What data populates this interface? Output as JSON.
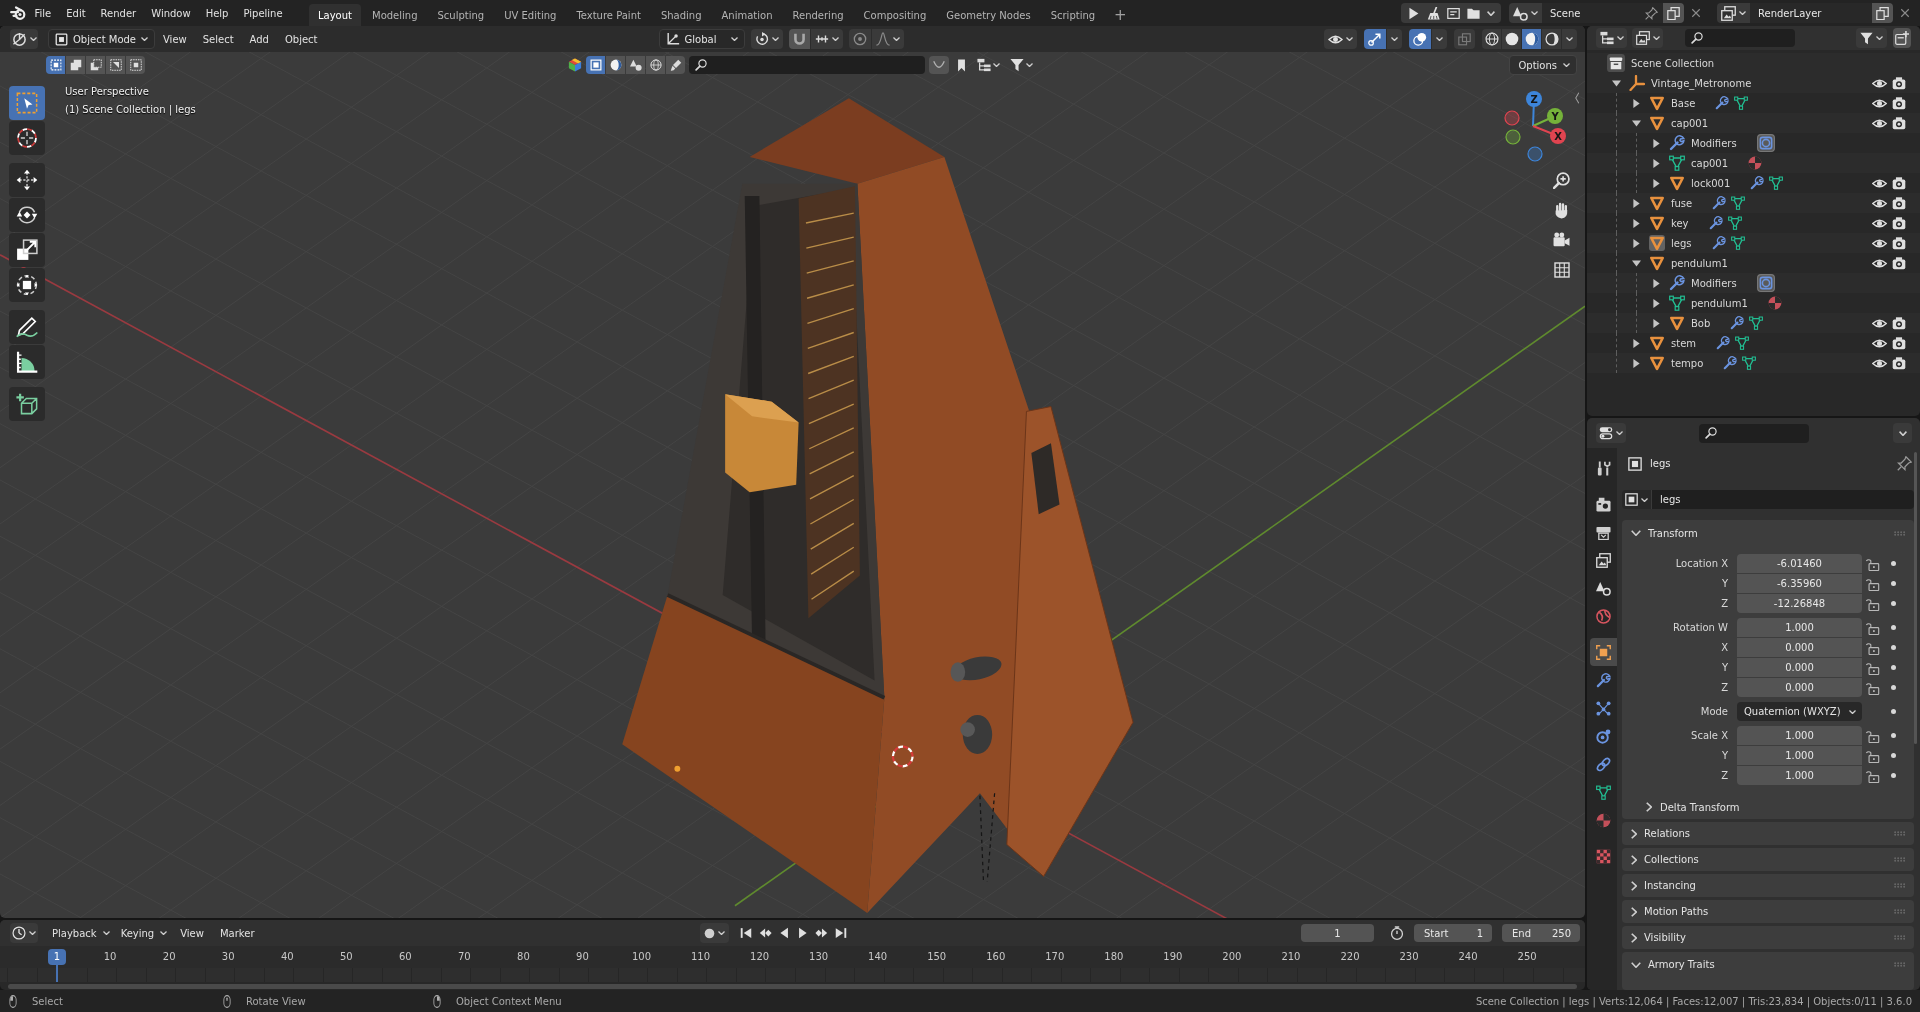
{
  "topbar": {
    "menus": [
      "File",
      "Edit",
      "Render",
      "Window",
      "Help",
      "Pipeline"
    ],
    "workspaces": [
      {
        "label": "Layout",
        "selected": true
      },
      {
        "label": "Modeling",
        "selected": false
      },
      {
        "label": "Sculpting",
        "selected": false
      },
      {
        "label": "UV Editing",
        "selected": false
      },
      {
        "label": "Texture Paint",
        "selected": false
      },
      {
        "label": "Shading",
        "selected": false
      },
      {
        "label": "Animation",
        "selected": false
      },
      {
        "label": "Rendering",
        "selected": false
      },
      {
        "label": "Compositing",
        "selected": false
      },
      {
        "label": "Geometry Nodes",
        "selected": false
      },
      {
        "label": "Scripting",
        "selected": false
      }
    ],
    "add_workspace": "+",
    "scene": "Scene",
    "view_layer": "RenderLayer"
  },
  "viewport": {
    "header": {
      "mode": "Object Mode",
      "menus": [
        "View",
        "Select",
        "Add",
        "Object"
      ],
      "orientation": "Global",
      "select_modes": [
        {
          "kind": "set",
          "selected": true
        },
        {
          "kind": "extend",
          "selected": false
        },
        {
          "kind": "subtract",
          "selected": false
        },
        {
          "kind": "invert",
          "selected": false
        },
        {
          "kind": "intersect",
          "selected": false
        }
      ],
      "filters": [
        {
          "kind": "object",
          "selected": true
        },
        {
          "kind": "sphere",
          "selected": false
        },
        {
          "kind": "shapes",
          "selected": false
        },
        {
          "kind": "world",
          "selected": false
        },
        {
          "kind": "brush",
          "selected": false
        }
      ],
      "show_gizmos": true,
      "show_overlays": true,
      "xray": false,
      "shading": [
        {
          "kind": "wireframe",
          "selected": false
        },
        {
          "kind": "solid",
          "selected": false
        },
        {
          "kind": "material",
          "selected": true
        },
        {
          "kind": "rendered",
          "selected": false
        }
      ],
      "options": "Options"
    },
    "info": [
      "User Perspective",
      "(1) Scene Collection | legs"
    ],
    "tools": [
      {
        "kind": "select",
        "selected": true
      },
      {
        "kind": "cursor",
        "selected": false
      },
      {
        "kind": "move",
        "selected": false
      },
      {
        "kind": "rotate",
        "selected": false
      },
      {
        "kind": "scale",
        "selected": false
      },
      {
        "kind": "transform",
        "selected": false
      },
      {
        "kind": "annotate",
        "selected": false
      },
      {
        "kind": "measure",
        "selected": false
      },
      {
        "kind": "add_cube",
        "selected": false
      }
    ],
    "gizmo": [
      {
        "label": "Z",
        "color": "#3d85da"
      },
      {
        "label": "Y",
        "color": "#75b23a"
      },
      {
        "label": "X",
        "color": "#e04450"
      }
    ]
  },
  "outliner": {
    "root": "Scene Collection",
    "tree": [
      {
        "name": "Vintage_Metronome",
        "kind": "empty",
        "expanded": true,
        "selected": false,
        "visible": true,
        "renderable": true,
        "children": [
          {
            "name": "Base",
            "kind": "object",
            "expanded": false,
            "selected": false,
            "visible": true,
            "renderable": true
          },
          {
            "name": "cap001",
            "kind": "object",
            "expanded": true,
            "selected": false,
            "visible": true,
            "renderable": true,
            "children": [
              {
                "name": "Modifiers",
                "kind": "modifiers",
                "expanded": false,
                "selected": false
              },
              {
                "name": "cap001",
                "kind": "mesh",
                "expanded": false,
                "selected": false
              },
              {
                "name": "lock001",
                "kind": "object",
                "expanded": false,
                "selected": false,
                "visible": true,
                "renderable": true
              }
            ]
          },
          {
            "name": "fuse",
            "kind": "object",
            "expanded": false,
            "selected": false,
            "visible": true,
            "renderable": true
          },
          {
            "name": "key",
            "kind": "object",
            "expanded": false,
            "selected": false,
            "visible": true,
            "renderable": true
          },
          {
            "name": "legs",
            "kind": "object",
            "expanded": false,
            "selected": true,
            "visible": true,
            "renderable": true
          },
          {
            "name": "pendulum1",
            "kind": "object",
            "expanded": true,
            "selected": false,
            "visible": true,
            "renderable": true,
            "children": [
              {
                "name": "Modifiers",
                "kind": "modifiers",
                "expanded": false,
                "selected": false
              },
              {
                "name": "pendulum1",
                "kind": "mesh",
                "expanded": false,
                "selected": false
              },
              {
                "name": "Bob",
                "kind": "object",
                "expanded": false,
                "selected": false,
                "visible": true,
                "renderable": true
              }
            ]
          },
          {
            "name": "stem",
            "kind": "object",
            "expanded": false,
            "selected": false,
            "visible": true,
            "renderable": true
          },
          {
            "name": "tempo",
            "kind": "object",
            "expanded": false,
            "selected": false,
            "visible": true,
            "renderable": true
          }
        ]
      }
    ]
  },
  "properties": {
    "tabs": [
      {
        "kind": "tool",
        "selected": false
      },
      {
        "kind": "render",
        "selected": false
      },
      {
        "kind": "output",
        "selected": false
      },
      {
        "kind": "view_layer",
        "selected": false
      },
      {
        "kind": "scene",
        "selected": false
      },
      {
        "kind": "world",
        "selected": false
      },
      {
        "kind": "object",
        "selected": true
      },
      {
        "kind": "modifiers",
        "selected": false
      },
      {
        "kind": "particles",
        "selected": false
      },
      {
        "kind": "physics",
        "selected": false
      },
      {
        "kind": "constraints",
        "selected": false
      },
      {
        "kind": "data",
        "selected": false
      },
      {
        "kind": "material",
        "selected": false
      },
      {
        "kind": "texture",
        "selected": false
      }
    ],
    "context": "legs",
    "name": "legs",
    "panels": [
      {
        "title": "Transform",
        "expanded": true,
        "groups": [
          [
            {
              "label": "Location X",
              "value": "-6.01460",
              "kind": "number",
              "locked": false
            },
            {
              "label": "Y",
              "value": "-6.35960",
              "kind": "number",
              "locked": false
            },
            {
              "label": "Z",
              "value": "-12.26848",
              "kind": "number",
              "locked": false
            }
          ],
          [
            {
              "label": "Rotation W",
              "value": "1.000",
              "kind": "number",
              "locked": false
            },
            {
              "label": "X",
              "value": "0.000",
              "kind": "number",
              "locked": false
            },
            {
              "label": "Y",
              "value": "0.000",
              "kind": "number",
              "locked": false
            },
            {
              "label": "Z",
              "value": "0.000",
              "kind": "number",
              "locked": false
            }
          ],
          [
            {
              "label": "Mode",
              "value": "Quaternion (WXYZ)",
              "kind": "dropdown"
            }
          ],
          [
            {
              "label": "Scale X",
              "value": "1.000",
              "kind": "number",
              "locked": false
            },
            {
              "label": "Y",
              "value": "1.000",
              "kind": "number",
              "locked": false
            },
            {
              "label": "Z",
              "value": "1.000",
              "kind": "number",
              "locked": false
            }
          ]
        ],
        "subpanels": [
          {
            "title": "Delta Transform",
            "expanded": false
          }
        ]
      },
      {
        "title": "Relations",
        "expanded": false
      },
      {
        "title": "Collections",
        "expanded": false
      },
      {
        "title": "Instancing",
        "expanded": false
      },
      {
        "title": "Motion Paths",
        "expanded": false
      },
      {
        "title": "Visibility",
        "expanded": false
      },
      {
        "title": "Armory Traits",
        "expanded": true
      }
    ]
  },
  "timeline": {
    "menus": [
      "Playback",
      "Keying",
      "View",
      "Marker"
    ],
    "auto_keying": false,
    "current_frame": "1",
    "start_label": "Start",
    "start": "1",
    "end_label": "End",
    "end": "250",
    "playhead": "1",
    "ticks": [
      "10",
      "20",
      "30",
      "40",
      "50",
      "60",
      "70",
      "80",
      "90",
      "100",
      "110",
      "120",
      "130",
      "140",
      "150",
      "160",
      "170",
      "180",
      "190",
      "200",
      "210",
      "220",
      "230",
      "240",
      "250"
    ]
  },
  "status_bar": {
    "hints": [
      {
        "kind": "left",
        "text": "Select"
      },
      {
        "kind": "middle",
        "text": "Rotate View"
      },
      {
        "kind": "right",
        "text": "Object Context Menu"
      }
    ],
    "stats": "Scene Collection | legs | Verts:12,064 | Faces:12,007 | Tris:23,834 | Objects:0/11 | 3.6.0"
  }
}
